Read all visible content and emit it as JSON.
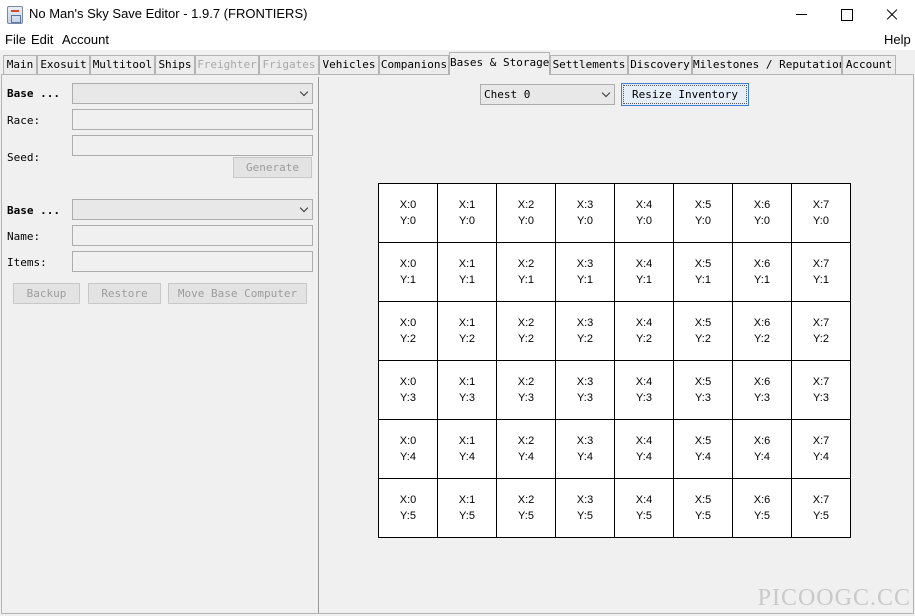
{
  "window": {
    "title": "No Man's Sky Save Editor - 1.9.7 (FRONTIERS)",
    "icon": "java-app-icon"
  },
  "menu": {
    "file": "File",
    "edit": "Edit",
    "account": "Account",
    "help": "Help"
  },
  "tabs": [
    {
      "label": "Main",
      "state": "enabled"
    },
    {
      "label": "Exosuit",
      "state": "enabled"
    },
    {
      "label": "Multitool",
      "state": "enabled"
    },
    {
      "label": "Ships",
      "state": "enabled"
    },
    {
      "label": "Freighter",
      "state": "disabled"
    },
    {
      "label": "Frigates",
      "state": "disabled"
    },
    {
      "label": "Vehicles",
      "state": "enabled"
    },
    {
      "label": "Companions",
      "state": "enabled"
    },
    {
      "label": "Bases & Storage",
      "state": "selected"
    },
    {
      "label": "Settlements",
      "state": "enabled"
    },
    {
      "label": "Discovery",
      "state": "enabled"
    },
    {
      "label": "Milestones / Reputation",
      "state": "enabled"
    },
    {
      "label": "Account",
      "state": "enabled"
    }
  ],
  "left": {
    "base_label": "Base ...",
    "race_label": "Race:",
    "seed_label": "Seed:",
    "generate_button": "Generate",
    "base2_label": "Base ...",
    "name_label": "Name:",
    "items_label": "Items:",
    "backup_button": "Backup",
    "restore_button": "Restore",
    "move_button": "Move Base Computer"
  },
  "right": {
    "chest_selected": "Chest 0",
    "resize_button": "Resize Inventory",
    "grid": {
      "columns": 8,
      "rows": 6,
      "x_prefix": "X:",
      "y_prefix": "Y:"
    }
  },
  "watermark": "PICOOGC.CC",
  "colors": {
    "focus_border": "#3c7fd2",
    "disabled_text": "#a8a8a8"
  }
}
